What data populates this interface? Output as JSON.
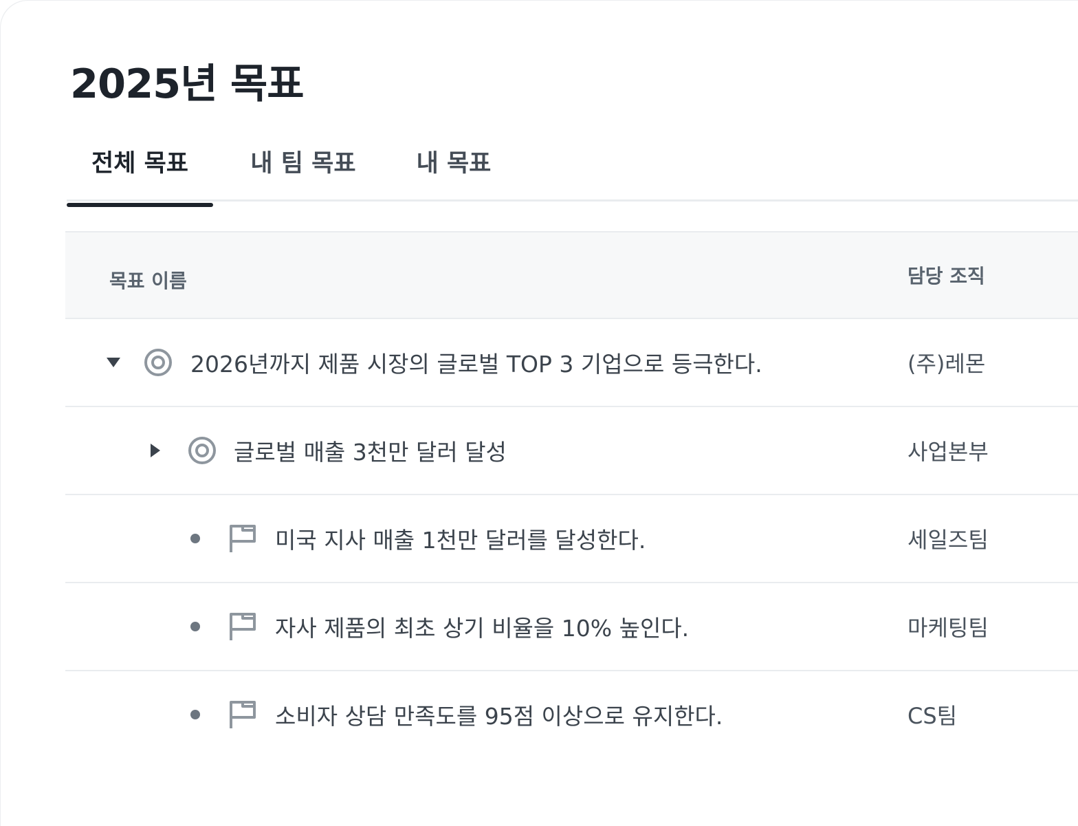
{
  "page": {
    "title": "2025년 목표"
  },
  "tabs": [
    {
      "label": "전체 목표",
      "active": true
    },
    {
      "label": "내 팀 목표",
      "active": false
    },
    {
      "label": "내 목표",
      "active": false
    }
  ],
  "table": {
    "columns": {
      "name": "목표 이름",
      "org": "담당 조직"
    },
    "rows": [
      {
        "name": "2026년까지 제품 시장의 글로벌 TOP 3 기업으로 등극한다.",
        "org": "(주)레몬",
        "icon": "target-icon",
        "toggle": "expanded"
      },
      {
        "name": "글로벌 매출 3천만 달러 달성",
        "org": "사업본부",
        "icon": "target-icon",
        "toggle": "collapsed"
      },
      {
        "name": "미국 지사 매출 1천만 달러를 달성한다.",
        "org": "세일즈팀",
        "icon": "flag-icon",
        "toggle": "none"
      },
      {
        "name": "자사 제품의 최초 상기 비율을 10% 높인다.",
        "org": "마케팅팀",
        "icon": "flag-icon",
        "toggle": "none"
      },
      {
        "name": "소비자 상담 만족도를 95점 이상으로 유지한다.",
        "org": "CS팀",
        "icon": "flag-icon",
        "toggle": "none"
      }
    ]
  },
  "colors": {
    "text_primary": "#1d232b",
    "text_secondary": "#3b434c",
    "icon": "#8e969e",
    "border": "#e9ecef",
    "header_bg": "#f7f8f9"
  }
}
